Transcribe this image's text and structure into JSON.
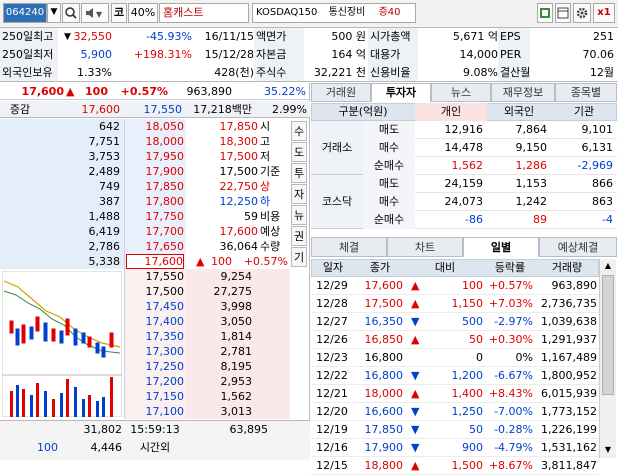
{
  "toolbar": {
    "code": "064240",
    "market_label": "코",
    "ratio": "40%",
    "name": "홈캐스트",
    "index": "KOSDAQ150",
    "sector": "통신장비",
    "margin": "증40",
    "close_label": "x1"
  },
  "info": {
    "r1": [
      "250일최고",
      "32,550",
      "-45.93%",
      "16/11/15",
      "액면가",
      "500 원",
      "시가총액",
      "5,671 억",
      "EPS",
      "251"
    ],
    "r2": [
      "250일최저",
      "5,900",
      "+198.31%",
      "15/12/28",
      "자본금",
      "164 억",
      "대용가",
      "14,000",
      "PER",
      "70.06"
    ],
    "r3": [
      "외국인보유",
      "1.33%",
      "",
      "428(천)",
      "주식수",
      "32,221 천",
      "신용비율",
      "9.08%",
      "결산월",
      "12월"
    ]
  },
  "quote": {
    "price": "17,600",
    "arrow": "▲",
    "change": "100",
    "rate": "+0.57%",
    "volume": "963,890",
    "vol_rate": "35.22%",
    "row2_label": "증감",
    "row2_a": "17,600",
    "row2_b": "17,550",
    "amount": "17,218백만",
    "amount_rate": "2.99%"
  },
  "ask": [
    [
      "642",
      "18,050"
    ],
    [
      "7,751",
      "18,000"
    ],
    [
      "3,753",
      "17,950"
    ],
    [
      "2,489",
      "17,900"
    ],
    [
      "749",
      "17,850"
    ],
    [
      "387",
      "17,800"
    ],
    [
      "1,488",
      "17,750"
    ],
    [
      "6,419",
      "17,700"
    ],
    [
      "2,786",
      "17,650"
    ],
    [
      "5,338",
      "17,600"
    ]
  ],
  "bid": [
    [
      "17,550",
      "9,254"
    ],
    [
      "17,500",
      "27,275"
    ],
    [
      "17,450",
      "3,998"
    ],
    [
      "17,400",
      "3,050"
    ],
    [
      "17,350",
      "1,814"
    ],
    [
      "17,300",
      "2,781"
    ],
    [
      "17,250",
      "8,195"
    ],
    [
      "17,200",
      "2,953"
    ],
    [
      "17,150",
      "1,562"
    ],
    [
      "17,100",
      "3,013"
    ]
  ],
  "stats": [
    [
      "17,850",
      "시"
    ],
    [
      "18,300",
      "고"
    ],
    [
      "17,500",
      "저"
    ],
    [
      "17,500",
      "기준"
    ],
    [
      "22,750",
      "상"
    ],
    [
      "12,250",
      "하"
    ],
    [
      "59",
      "비용"
    ],
    [
      "17,600",
      "예상"
    ],
    [
      "36,064",
      "수량"
    ]
  ],
  "stats_last": {
    "arrow": "▲",
    "change": "100",
    "rate": "+0.57%"
  },
  "vtabs": [
    "수",
    "도",
    "투",
    "자",
    "뉴",
    "권",
    "기"
  ],
  "bottom": {
    "ask_total": "31,802",
    "time": "15:59:13",
    "bid_total": "63,895",
    "b2_a": "100",
    "b2_b": "4,446",
    "b2_c": "시간외"
  },
  "right_tabs1": [
    "거래원",
    "투자자",
    "뉴스",
    "재무정보",
    "종목별"
  ],
  "investor": {
    "head": [
      "구분(억원)",
      "개인",
      "외국인",
      "기관"
    ],
    "groups": [
      {
        "name": "거래소",
        "rows": [
          [
            "매도",
            "12,916",
            "7,864",
            "9,101"
          ],
          [
            "매수",
            "14,478",
            "9,150",
            "6,131"
          ],
          [
            "순매수",
            "1,562",
            "1,286",
            "-2,969"
          ]
        ]
      },
      {
        "name": "코스닥",
        "rows": [
          [
            "매도",
            "24,159",
            "1,153",
            "866"
          ],
          [
            "매수",
            "24,073",
            "1,242",
            "863"
          ],
          [
            "순매수",
            "-86",
            "89",
            "-4"
          ]
        ]
      }
    ]
  },
  "right_tabs2": [
    "체결",
    "차트",
    "일별",
    "예상체결"
  ],
  "daily": {
    "head": [
      "일자",
      "종가",
      "대비",
      "등락률",
      "거래량"
    ],
    "rows": [
      [
        "12/29",
        "17,600",
        "▲",
        "100",
        "+0.57%",
        "963,890",
        "up"
      ],
      [
        "12/28",
        "17,500",
        "▲",
        "1,150",
        "+7.03%",
        "2,736,735",
        "up"
      ],
      [
        "12/27",
        "16,350",
        "▼",
        "500",
        "-2.97%",
        "1,039,638",
        "dn"
      ],
      [
        "12/26",
        "16,850",
        "▲",
        "50",
        "+0.30%",
        "1,291,937",
        "up"
      ],
      [
        "12/23",
        "16,800",
        "",
        "0",
        "0%",
        "1,167,489",
        "blk"
      ],
      [
        "12/22",
        "16,800",
        "▼",
        "1,200",
        "-6.67%",
        "1,800,952",
        "dn"
      ],
      [
        "12/21",
        "18,000",
        "▲",
        "1,400",
        "+8.43%",
        "6,015,939",
        "up"
      ],
      [
        "12/20",
        "16,600",
        "▼",
        "1,250",
        "-7.00%",
        "1,773,152",
        "dn"
      ],
      [
        "12/19",
        "17,850",
        "▼",
        "50",
        "-0.28%",
        "1,226,199",
        "dn"
      ],
      [
        "12/16",
        "17,900",
        "▼",
        "900",
        "-4.79%",
        "1,531,162",
        "dn"
      ],
      [
        "12/15",
        "18,800",
        "▲",
        "1,500",
        "+8.67%",
        "3,811,847",
        "up"
      ]
    ]
  },
  "colors": {
    "up": "#e00000",
    "down": "#0040d0",
    "ask_bg": "#e4eefa",
    "bid_bg": "#fbe9ea",
    "header_bg": "#dde5ee"
  }
}
